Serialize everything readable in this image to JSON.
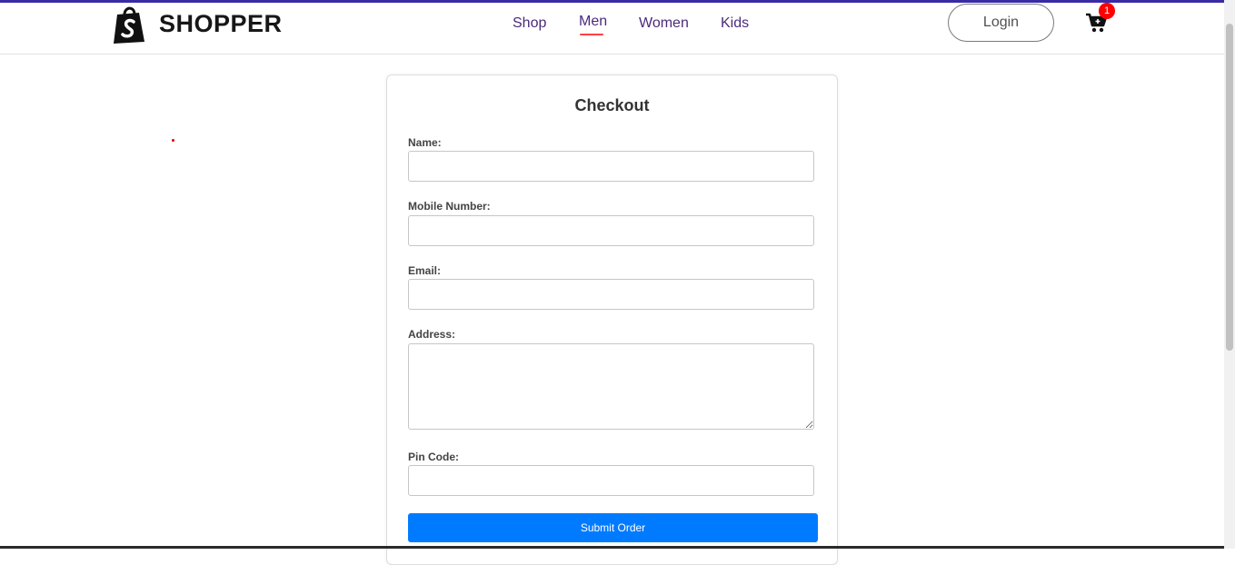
{
  "brand": {
    "name": "SHOPPER",
    "logo_icon": "shopping-bag-icon"
  },
  "nav": {
    "items": [
      {
        "label": "Shop",
        "active": false
      },
      {
        "label": "Men",
        "active": true
      },
      {
        "label": "Women",
        "active": false
      },
      {
        "label": "Kids",
        "active": false
      }
    ],
    "active_underline_color": "#ff4141"
  },
  "header": {
    "login_label": "Login",
    "cart_icon": "cart-icon",
    "cart_count": "1"
  },
  "checkout": {
    "title": "Checkout",
    "fields": {
      "name_label": "Name:",
      "mobile_label": "Mobile Number:",
      "email_label": "Email:",
      "address_label": "Address:",
      "pincode_label": "Pin Code:"
    },
    "values": {
      "name": "",
      "mobile": "",
      "email": "",
      "address": "",
      "pincode": ""
    },
    "submit_label": "Submit Order",
    "submit_color": "#007bff"
  }
}
